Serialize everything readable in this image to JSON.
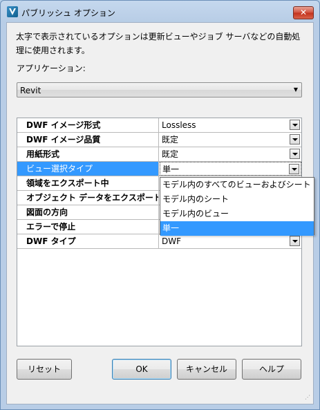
{
  "window": {
    "title": "パブリッシュ オプション",
    "close_label": "✕"
  },
  "description": "太字で表示されているオプションは更新ビューやジョブ サーバなどの自動処理に使用されます。",
  "application": {
    "label": "アプリケーション:",
    "value": "Revit"
  },
  "grid": {
    "rows": [
      {
        "name": "DWF イメージ形式",
        "value": "Lossless"
      },
      {
        "name": "DWF イメージ品質",
        "value": "既定"
      },
      {
        "name": "用紙形式",
        "value": "既定"
      },
      {
        "name": "ビュー選択タイプ",
        "value": "単一"
      },
      {
        "name": "領域をエクスポート中",
        "value": ""
      },
      {
        "name": "オブジェクト データをエクスポート",
        "value": ""
      },
      {
        "name": "図面の方向",
        "value": ""
      },
      {
        "name": "エラーで停止",
        "value": ""
      },
      {
        "name": "DWF タイプ",
        "value": "DWF"
      }
    ]
  },
  "dropdown": {
    "options": [
      "モデル内のすべてのビューおよびシート",
      "モデル内のシート",
      "モデル内のビュー",
      "単一"
    ],
    "selected": "単一"
  },
  "buttons": {
    "reset": "リセット",
    "ok": "OK",
    "cancel": "キャンセル",
    "help": "ヘルプ"
  }
}
